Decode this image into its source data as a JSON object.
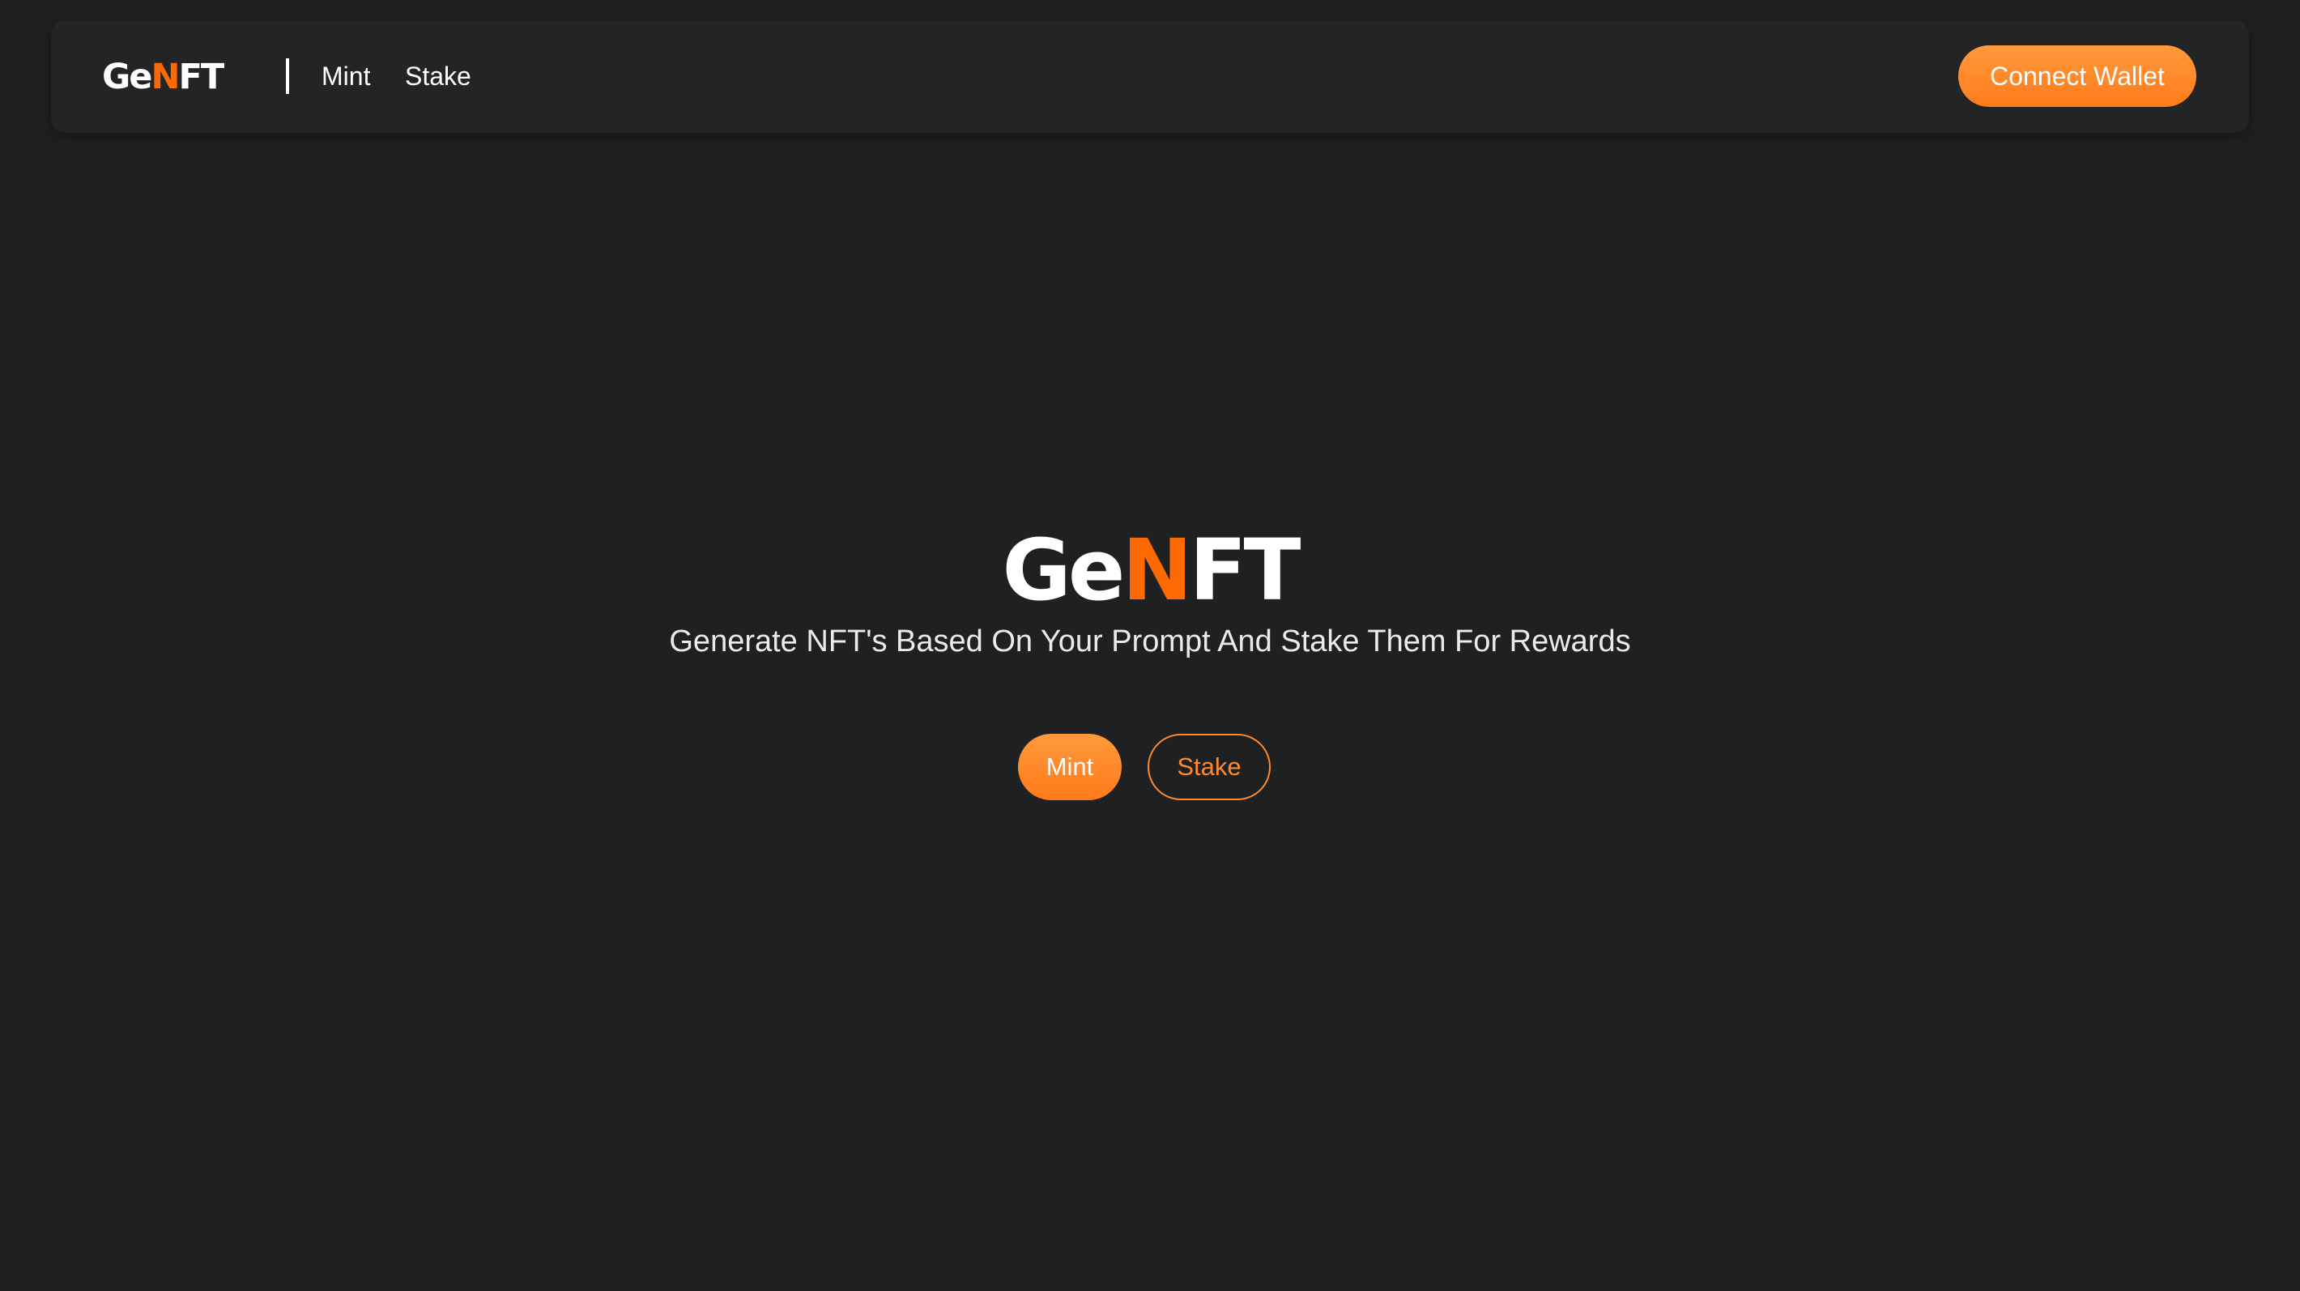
{
  "navbar": {
    "logo": {
      "prefix": "Ge",
      "accent": "N",
      "suffix": "FT"
    },
    "links": [
      {
        "label": "Mint"
      },
      {
        "label": "Stake"
      }
    ],
    "connect_wallet_label": "Connect Wallet"
  },
  "hero": {
    "title": {
      "prefix": "Ge",
      "accent": "N",
      "suffix": "FT"
    },
    "subtitle": "Generate NFT's Based On Your Prompt And Stake Them For Rewards",
    "buttons": {
      "mint_label": "Mint",
      "stake_label": "Stake"
    }
  },
  "colors": {
    "background": "#1f2022",
    "navbar_background": "#232426",
    "accent": "#ff6a00",
    "button_gradient_top": "#ff9a3c",
    "button_gradient_bottom": "#ff7a1a",
    "text": "#ffffff"
  }
}
